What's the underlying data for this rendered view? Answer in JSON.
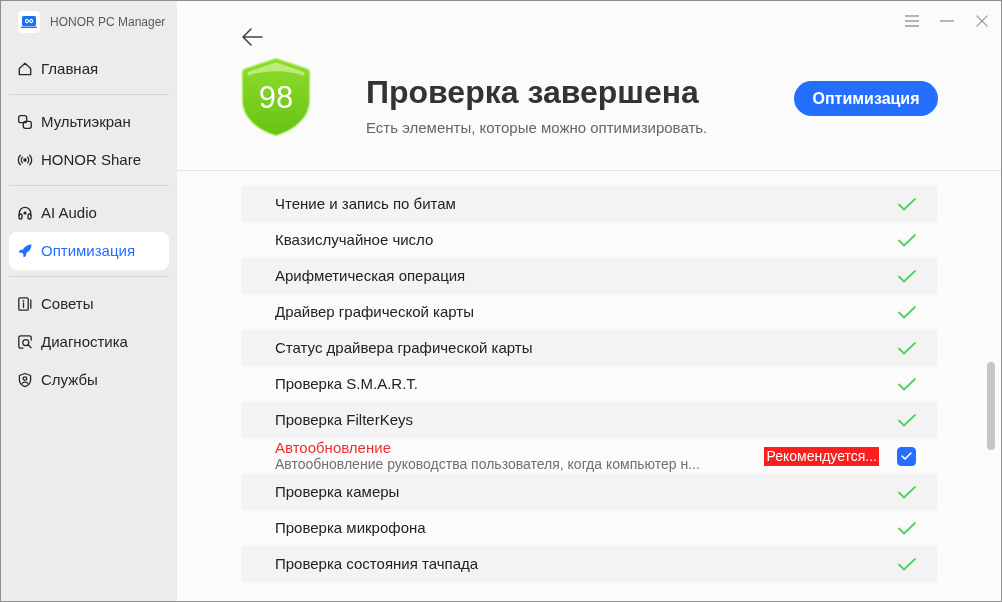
{
  "window": {
    "app_name": "HONOR PC Manager"
  },
  "sidebar": {
    "groups": [
      {
        "items": [
          {
            "label": "Главная",
            "selected": false
          }
        ]
      },
      {
        "items": [
          {
            "label": "Мультиэкран",
            "selected": false
          },
          {
            "label": "HONOR Share",
            "selected": false
          }
        ]
      },
      {
        "items": [
          {
            "label": "AI Audio",
            "selected": false
          },
          {
            "label": "Оптимизация",
            "selected": true
          }
        ]
      },
      {
        "items": [
          {
            "label": "Советы",
            "selected": false
          },
          {
            "label": "Диагностика",
            "selected": false
          },
          {
            "label": "Службы",
            "selected": false
          }
        ]
      }
    ]
  },
  "header": {
    "score": "98",
    "title": "Проверка завершена",
    "subtitle": "Есть элементы, которые можно оптимизировать.",
    "action_button": "Оптимизация"
  },
  "checks": [
    {
      "kind": "passed",
      "label": "Чтение и запись по битам"
    },
    {
      "kind": "passed",
      "label": "Квазислучайное число"
    },
    {
      "kind": "passed",
      "label": "Арифметическая операция"
    },
    {
      "kind": "passed",
      "label": "Драйвер графической карты"
    },
    {
      "kind": "passed",
      "label": "Статус драйвера графической карты"
    },
    {
      "kind": "passed",
      "label": "Проверка S.M.A.R.T."
    },
    {
      "kind": "passed",
      "label": "Проверка FilterKeys"
    },
    {
      "kind": "issue",
      "label": "Автообновление",
      "description": "Автообновление руководства пользователя, когда компьютер н...",
      "badge": "Рекомендуется...",
      "checked": true
    },
    {
      "kind": "passed",
      "label": "Проверка камеры"
    },
    {
      "kind": "passed",
      "label": "Проверка микрофона"
    },
    {
      "kind": "passed",
      "label": "Проверка состояния тачпада"
    }
  ]
}
